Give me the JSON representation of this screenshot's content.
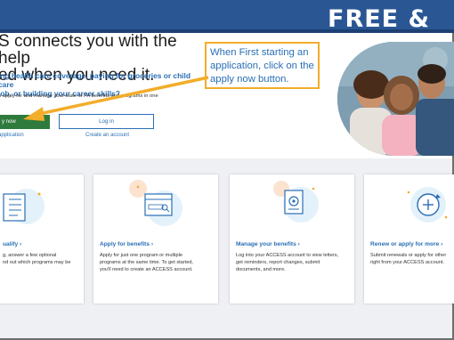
{
  "header": {
    "banner_text": "FREE &"
  },
  "hero": {
    "title": "S connects you with the help\ned when you need it.",
    "subtitle": "ing health care coverage, paying for groceries or child care\n job, or building your career skills?",
    "description": "n apply for and manage your state of PA benefits and programs in one",
    "apply_button": "y now",
    "login_button": "Log in",
    "apply_link": "application",
    "create_link": "Create an account"
  },
  "callout": {
    "text": "When First starting an application, click on the apply now button."
  },
  "cards": [
    {
      "title": "ualify ›",
      "text": "g, answer a few optional\nnd out which programs may be",
      "icon": "checklist-icon"
    },
    {
      "title": "Apply for benefits ›",
      "text": "Apply for just one program or multiple\nprograms at the same time. To get started,\nyou'll need to create an ACCESS account.",
      "icon": "browser-search-icon"
    },
    {
      "title": "Manage your benefits ›",
      "text": "Log into your ACCESS account to view letters,\nget reminders, report changes, submit\ndocuments, and more.",
      "icon": "document-gear-icon"
    },
    {
      "title": "Renew or apply for more ›",
      "text": "Submit renewals or apply for other\nright from your ACCESS account.",
      "icon": "renew-plus-icon"
    }
  ],
  "colors": {
    "header_blue": "#2a5694",
    "link_blue": "#2a6fb5",
    "apply_green": "#2f7b3d",
    "callout_border": "#f2ad2a"
  }
}
